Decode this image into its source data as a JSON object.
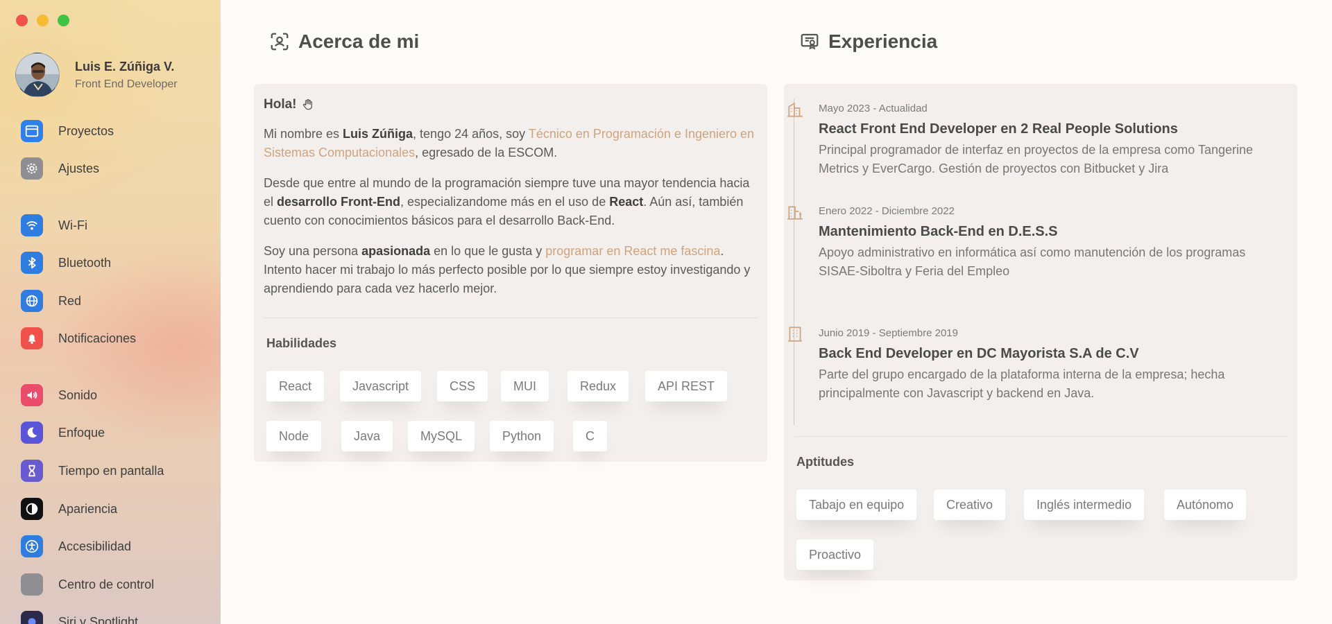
{
  "profile": {
    "name": "Luis E. Zúñiga V.",
    "role": "Front End Developer"
  },
  "sidebar": {
    "items": [
      {
        "label": "Proyectos",
        "icon": "browser-window-icon",
        "color": "#2f80ed"
      },
      {
        "label": "Ajustes",
        "icon": "gear-icon",
        "color": "#8e8e93"
      },
      {
        "label": "Wi-Fi",
        "icon": "wifi-icon",
        "color": "#2f7de1"
      },
      {
        "label": "Bluetooth",
        "icon": "bluetooth-icon",
        "color": "#2f7de1"
      },
      {
        "label": "Red",
        "icon": "globe-icon",
        "color": "#2f7de1"
      },
      {
        "label": "Notificaciones",
        "icon": "bell-icon",
        "color": "#f0514a"
      },
      {
        "label": "Sonido",
        "icon": "speaker-icon",
        "color": "#ea4c6b"
      },
      {
        "label": "Enfoque",
        "icon": "moon-icon",
        "color": "#5a54d6"
      },
      {
        "label": "Tiempo en pantalla",
        "icon": "hourglass-icon",
        "color": "#6a5ad0"
      },
      {
        "label": "Apariencia",
        "icon": "appearance-icon",
        "color": "#111111"
      },
      {
        "label": "Accesibilidad",
        "icon": "accessibility-icon",
        "color": "#2f7de1"
      },
      {
        "label": "Centro de control",
        "icon": "control-center-icon",
        "color": "#8e8e93"
      },
      {
        "label": "Siri y Spotlight",
        "icon": "siri-icon",
        "color": "#2c2a4a"
      }
    ]
  },
  "about": {
    "title": "Acerca de mi",
    "hello": "Hola!",
    "p1": {
      "a": "Mi nombre es ",
      "name": "Luis Zúñiga",
      "b": ", tengo 24 años, soy ",
      "degree": "Técnico en Programación e Ingeniero en Sistemas Computacionales",
      "c": ", egresado de la ESCOM."
    },
    "p2": {
      "a": "Desde que entre al mundo de la programación siempre tuve una mayor tendencia hacia el ",
      "focus": "desarrollo Front-End",
      "b": ", especializandome más en el uso de ",
      "react": "React",
      "c": ". Aún así, también cuento con conocimientos básicos para el desarrollo Back-End."
    },
    "p3": {
      "a": "Soy una persona ",
      "passion": "apasionada",
      "b": " en lo que le gusta y ",
      "love": "programar en React me fascina",
      "c": ". Intento hacer mi trabajo lo más perfecto posible por lo que siempre estoy investigando y aprendiendo para cada vez hacerlo mejor."
    },
    "skills_title": "Habilidades",
    "skills": [
      "React",
      "Javascript",
      "CSS",
      "MUI",
      "Redux",
      "API REST",
      "Node",
      "Java",
      "MySQL",
      "Python",
      "C"
    ]
  },
  "experience": {
    "title": "Experiencia",
    "items": [
      {
        "date": "Mayo 2023 - Actualidad",
        "title": "React Front End Developer en 2 Real People Solutions",
        "desc": "Principal programador de interfaz en proyectos de la empresa como Tangerine Metrics y EverCargo. Gestión de proyectos con Bitbucket y Jira"
      },
      {
        "date": "Enero 2022 - Diciembre 2022",
        "title": "Mantenimiento Back-End en D.E.S.S",
        "desc": "Apoyo administrativo en informática así como manutención de los programas SISAE-Siboltra y Feria del Empleo"
      },
      {
        "date": "Junio 2019 - Septiembre 2019",
        "title": "Back End Developer en DC Mayorista S.A de C.V",
        "desc": "Parte del grupo encargado de la plataforma interna de la empresa; hecha principalmente con Javascript y backend en Java."
      }
    ],
    "aptitudes_title": "Aptitudes",
    "aptitudes": [
      "Tabajo en equipo",
      "Creativo",
      "Inglés intermedio",
      "Autónomo",
      "Proactivo"
    ]
  },
  "colors": {
    "accent": "#d0a37f",
    "card": "#f2efec",
    "background": "#fcfbf9"
  }
}
